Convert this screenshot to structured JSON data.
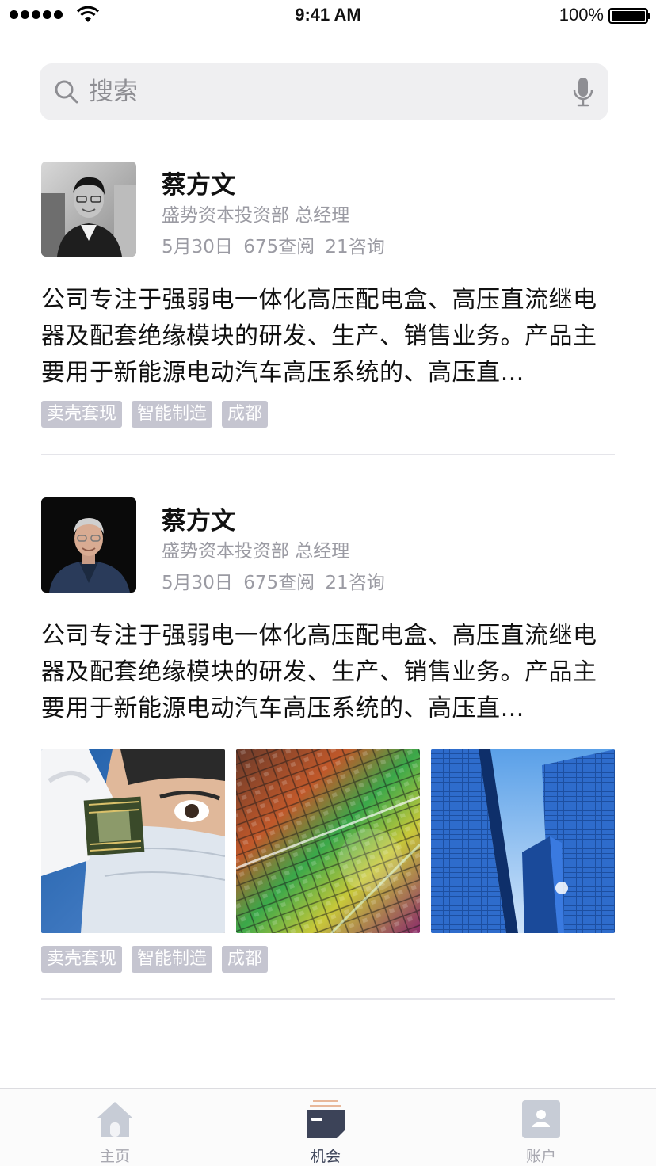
{
  "status_bar": {
    "time": "9:41 AM",
    "battery": "100%"
  },
  "search": {
    "placeholder": "搜索",
    "icon": "search-icon",
    "mic_icon": "microphone-icon"
  },
  "feed": [
    {
      "name": "蔡方文",
      "company_title": "盛势资本投资部 总经理",
      "stats": "5月30日 675查阅 21咨询",
      "description": "公司专注于强弱电一体化高压配电盒、高压直流继电器及配套绝缘模块的研发、生产、销售业务。产品主要用于新能源电动汽车高压系统的、高压直…",
      "tags": [
        "卖壳套现",
        "智能制造",
        "成都"
      ]
    },
    {
      "name": "蔡方文",
      "company_title": "盛势资本投资部 总经理",
      "stats": "5月30日 675查阅 21咨询",
      "description": "公司专注于强弱电一体化高压配电盒、高压直流继电器及配套绝缘模块的研发、生产、销售业务。产品主要用于新能源电动汽车高压系统的、高压直…",
      "tags": [
        "卖壳套现",
        "智能制造",
        "成都"
      ],
      "photos": [
        "chip-inspection-photo",
        "silicon-wafer-photo",
        "skyscraper-photo"
      ]
    }
  ],
  "tabbar": {
    "tabs": [
      {
        "label": "主页",
        "icon": "home-icon",
        "active": false
      },
      {
        "label": "机会",
        "icon": "opportunity-icon",
        "active": true
      },
      {
        "label": "账户",
        "icon": "account-icon",
        "active": false
      }
    ]
  },
  "colors": {
    "tag_bg": "#c5c5d0",
    "meta_text": "#9b9ba3",
    "active_tab": "#3c4358",
    "inactive_tab": "#a8a8b0",
    "search_bg": "#efeff1"
  }
}
